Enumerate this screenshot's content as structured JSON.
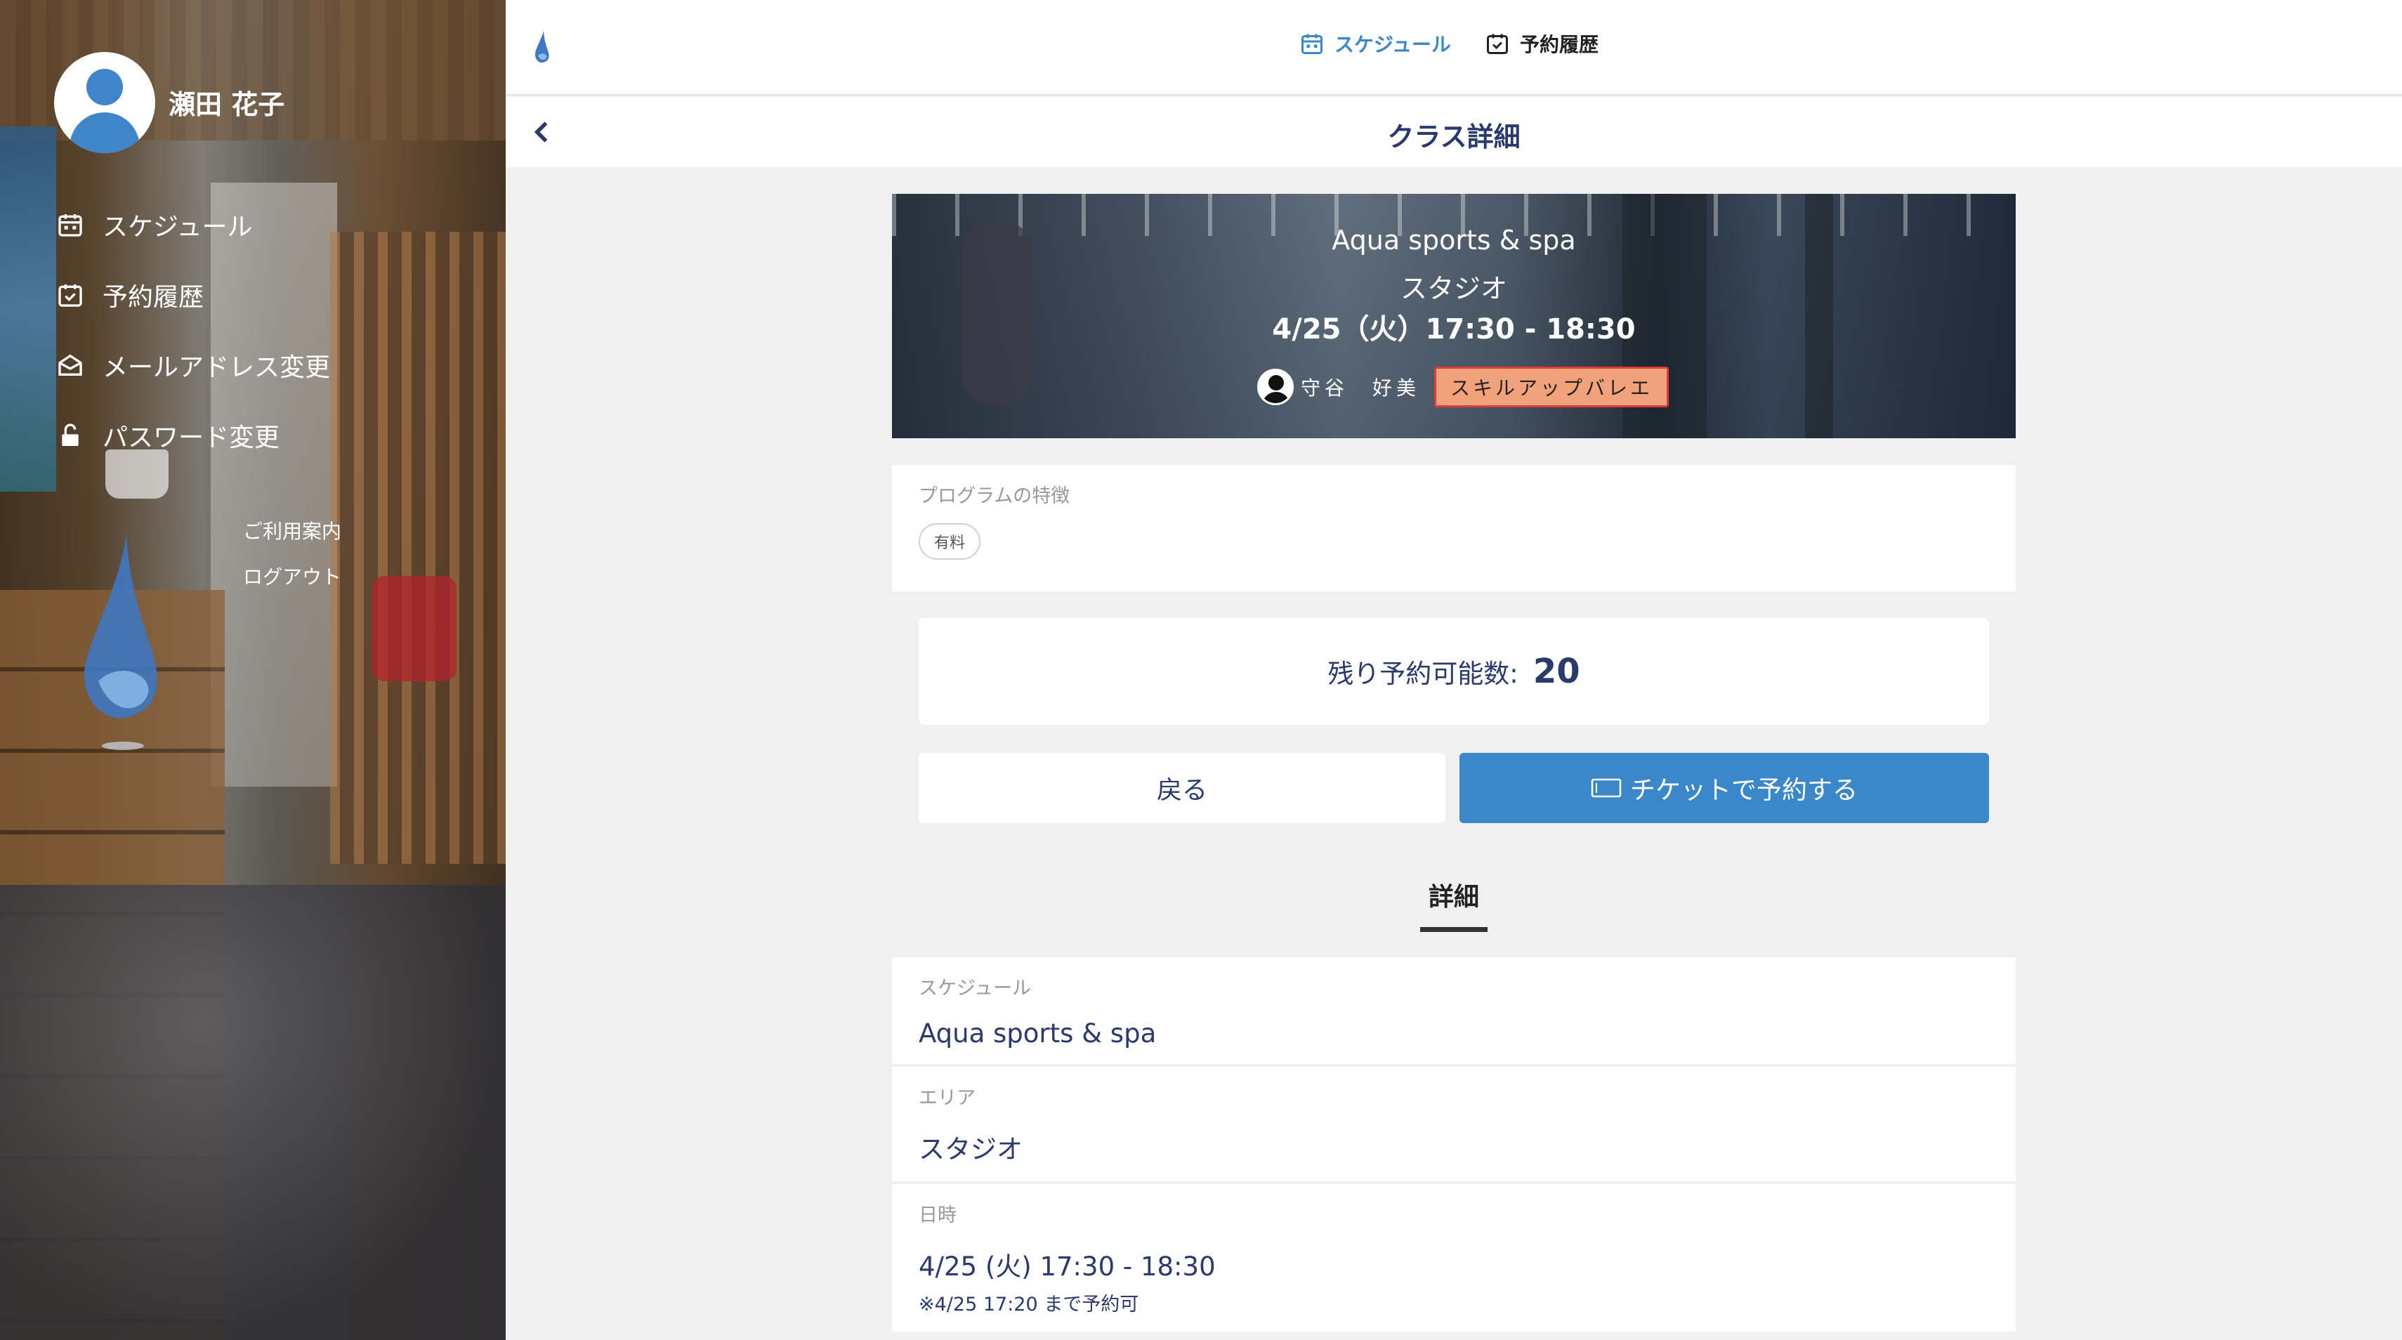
{
  "user": {
    "name": "瀬田 花子"
  },
  "sidebar": {
    "items": [
      {
        "label": "スケジュール",
        "icon": "calendar-icon"
      },
      {
        "label": "予約履歴",
        "icon": "calendar-check-icon"
      },
      {
        "label": "メールアドレス変更",
        "icon": "envelope-open-icon"
      },
      {
        "label": "パスワード変更",
        "icon": "unlock-icon"
      }
    ],
    "links": [
      "ご利用案内",
      "ログアウト"
    ]
  },
  "topbar": {
    "tabs": [
      {
        "label": "スケジュール",
        "icon": "calendar-icon",
        "active": true
      },
      {
        "label": "予約履歴",
        "icon": "calendar-check-icon",
        "active": false
      }
    ]
  },
  "page": {
    "title": "クラス詳細"
  },
  "hero": {
    "line1": "Aqua sports & spa",
    "line2": "スタジオ",
    "line3": "4/25（火）17:30 - 18:30",
    "instructor": "守谷　好美",
    "genre": "スキルアップバレエ"
  },
  "features": {
    "label": "プログラムの特徴",
    "chip": "有料"
  },
  "remaining": {
    "label": "残り予約可能数:",
    "count": "20"
  },
  "buttons": {
    "back": "戻る",
    "book": "チケットで予約する"
  },
  "details": {
    "heading": "詳細",
    "rows": [
      {
        "label": "スケジュール",
        "value": "Aqua sports & spa"
      },
      {
        "label": "エリア",
        "value": "スタジオ"
      },
      {
        "label": "日時",
        "value": "4/25 (火) 17:30 - 18:30",
        "note": "※4/25 17:20 まで予約可"
      }
    ]
  },
  "colors": {
    "accent": "#3a87c9",
    "navy": "#2a3a6a",
    "genre_tag": "#f2a27a"
  }
}
